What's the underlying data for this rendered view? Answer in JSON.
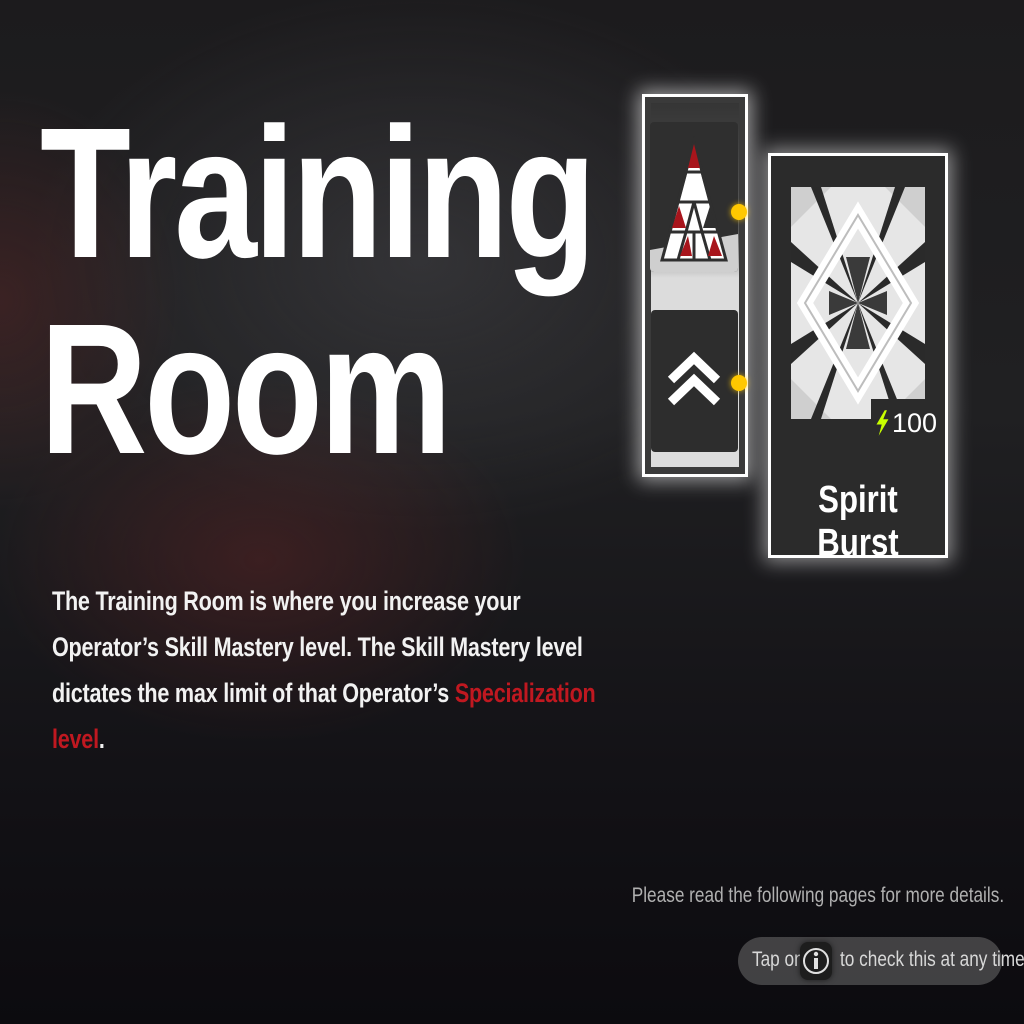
{
  "title": {
    "line1": "Training",
    "line2": "Room"
  },
  "description": {
    "part1": "The Training Room is where you increase your Operator’s Skill Mastery level. The Skill Mastery level dictates the max limit of that Operator’s ",
    "highlight": "Specialization level",
    "part2": "."
  },
  "skill": {
    "name": "Spirit Burst",
    "cost": "100",
    "cost_icon": "lightning-icon"
  },
  "footer": {
    "hint": "Please read the following pages for more details.",
    "tap_before": "Tap on",
    "tap_after": "to check this at any time",
    "info_icon": "info-icon"
  },
  "colors": {
    "highlight": "#c01820",
    "indicator": "#ffc800",
    "energy": "#c8ff00"
  }
}
